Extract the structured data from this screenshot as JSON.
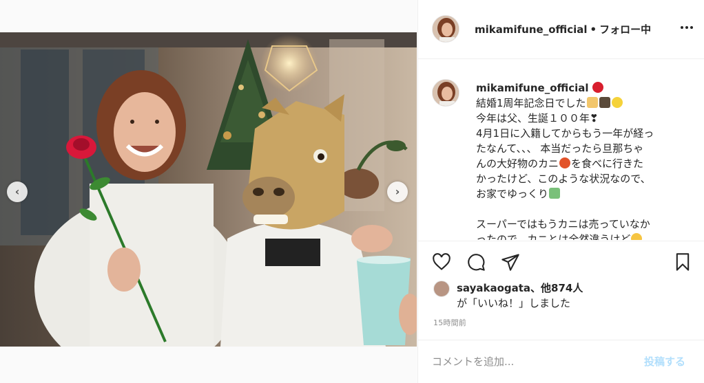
{
  "post": {
    "username": "mikamifune_official",
    "follow_status": "フォロー中",
    "separator": "•"
  },
  "carousel": {
    "prev_glyph": "‹",
    "next_glyph": "›",
    "dot_count": 5,
    "active_dot": 1
  },
  "caption": {
    "username": "mikamifune_official",
    "lines": [
      "結婚1周年記念日でした",
      "今年は父、生誕１００年❣",
      "4月1日に入籍してからもう一年が経っ",
      "たなんて、、、 本当だったら旦那ちゃ",
      "んの大好物のカニ",
      "を食べに行きた",
      "かったけど、このような状況なので、",
      "お家でゆっくり",
      "スーパーではもうカニは売っていなか",
      "ったので、カニとは全然違うけど"
    ],
    "emoji": {
      "rose": "rose-emoji",
      "couple1": "bride-emoji",
      "couple2": "groom-emoji",
      "sparkle": "sparkles-emoji",
      "crab": "crab-emoji",
      "house": "house-emoji",
      "smile": "smile-emoji"
    }
  },
  "actions": {
    "like_icon": "heart-icon",
    "comment_icon": "comment-icon",
    "share_icon": "share-icon",
    "save_icon": "bookmark-icon"
  },
  "likes": {
    "first_liker": "sayakaogata",
    "others": "、他874人",
    "suffix": "が「いいね！」しました"
  },
  "timestamp": "15時間前",
  "comment": {
    "placeholder": "コメントを追加...",
    "post_label": "投稿する"
  },
  "colors": {
    "accent_disabled": "#b2dffc",
    "border": "#efefef",
    "muted_text": "#8e8e8e"
  }
}
